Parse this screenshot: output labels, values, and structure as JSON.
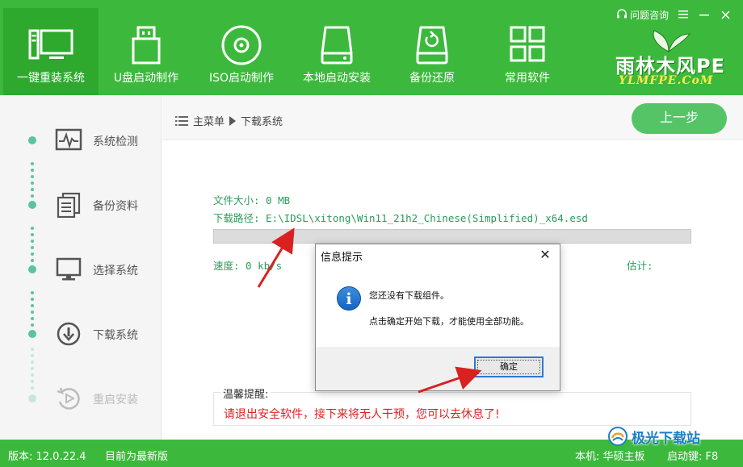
{
  "app": {
    "help_label": "问题咨询",
    "brand_name": "雨林木风PE",
    "brand_url": "YLMFPE.CoM"
  },
  "nav": [
    {
      "label": "一键重装系统",
      "icon": "monitor-pc-icon",
      "active": true
    },
    {
      "label": "U盘启动制作",
      "icon": "usb-drive-icon"
    },
    {
      "label": "ISO启动制作",
      "icon": "disc-icon"
    },
    {
      "label": "本地启动安装",
      "icon": "hard-drive-icon"
    },
    {
      "label": "备份还原",
      "icon": "backup-drive-icon"
    },
    {
      "label": "常用软件",
      "icon": "apps-grid-icon"
    }
  ],
  "steps": [
    {
      "label": "系统检测",
      "icon": "pulse-monitor-icon"
    },
    {
      "label": "备份资料",
      "icon": "document-copy-icon"
    },
    {
      "label": "选择系统",
      "icon": "monitor-icon"
    },
    {
      "label": "下载系统",
      "icon": "download-circle-icon"
    },
    {
      "label": "重启安装",
      "icon": "restart-icon",
      "disabled": true
    }
  ],
  "breadcrumb": {
    "home": "主菜单",
    "current": "下载系统"
  },
  "back_button": "上一步",
  "download": {
    "file_size": "文件大小: 0 MB",
    "path": "下载路径: E:\\IDSL\\xitong\\Win11_21h2_Chinese(Simplified)_x64.esd",
    "speed": "速度: 0 kb/s",
    "estimate": "估计:",
    "progress": 0
  },
  "tips": {
    "title": "温馨提醒:",
    "text": "请退出安全软件，接下来将无人干预，您可以去休息了!"
  },
  "status": {
    "version": "版本: 12.0.22.4",
    "update": "目前为最新版",
    "machine": "本机: 华硕主板",
    "hotkey": "启动键: F8"
  },
  "dialog": {
    "title": "信息提示",
    "message1": "您还没有下载组件。",
    "message2": "点击确定开始下载，才能使用全部功能。",
    "ok": "确定",
    "close": "✕"
  },
  "watermark": "极光下载站",
  "colors": {
    "brand_green": "#3cb93c",
    "accent_text": "#2b9a5a",
    "warning_red": "#e01f1f",
    "annotation_red": "#d92121"
  }
}
